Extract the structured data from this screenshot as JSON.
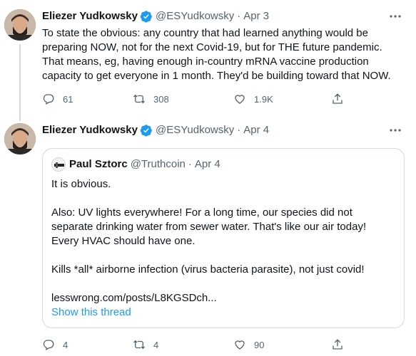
{
  "tweets": [
    {
      "author_name": "Eliezer Yudkowsky",
      "handle": "@ESYudkowsky",
      "separator": "·",
      "date": "Apr 3",
      "text": "To state the obvious: any country that had learned anything would be preparing NOW, not for the next Covid-19, but for THE future pandemic. That means, eg, having enough in-country mRNA vaccine production capacity to get everyone in 1 month.  They'd be building toward that NOW.",
      "replies": "61",
      "retweets": "308",
      "likes": "1.9K"
    },
    {
      "author_name": "Eliezer Yudkowsky",
      "handle": "@ESYudkowsky",
      "separator": "·",
      "date": "Apr 4",
      "replies": "4",
      "retweets": "4",
      "likes": "90",
      "quote": {
        "author_name": "Paul Sztorc",
        "handle": "@Truthcoin",
        "separator": "·",
        "date": "Apr 4",
        "paragraphs": [
          "It is obvious.",
          "Also: UV lights everywhere! For a long time, our species did not separate drinking water from sewer water. That's like our air today! Every HVAC should have one.",
          "Kills *all* airborne infection (virus bacteria parasite), not just covid!",
          "lesswrong.com/posts/L8KGSDch..."
        ],
        "show_thread": "Show this thread"
      }
    }
  ],
  "colors": {
    "accent": "#1d9bf0",
    "muted": "#536471",
    "border": "#cfd9de"
  },
  "icons": [
    "verified-badge-icon",
    "more-icon",
    "reply-icon",
    "retweet-icon",
    "like-icon",
    "share-icon"
  ]
}
